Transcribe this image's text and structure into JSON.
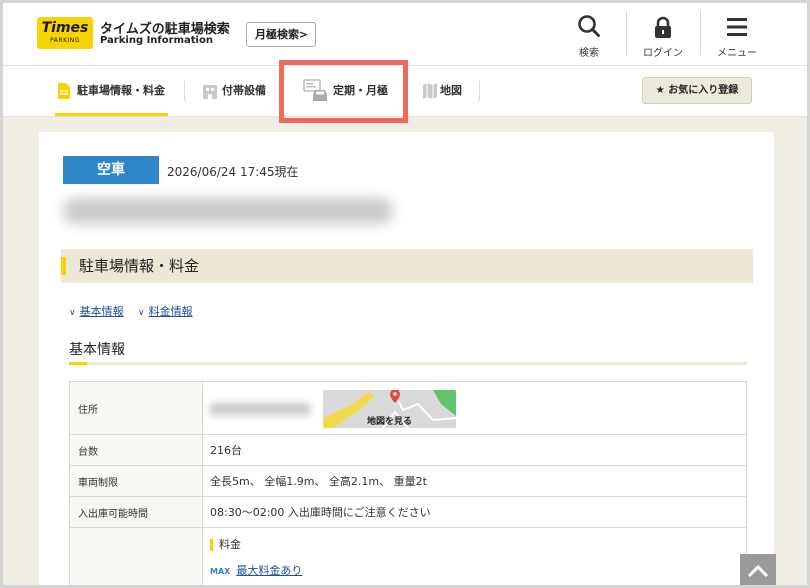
{
  "header": {
    "logo_text": "Times",
    "logo_sub": "PARKING",
    "site_title": "タイムズの駐車場検索",
    "site_subtitle": "Parking Information",
    "monthly_search_label": "月極検索",
    "icons": [
      {
        "name": "search-icon",
        "label": "検索"
      },
      {
        "name": "lock-icon",
        "label": "ログイン"
      },
      {
        "name": "menu-icon",
        "label": "メニュー"
      }
    ]
  },
  "tabs": {
    "items": [
      {
        "label": "駐車場情報・料金",
        "icon": "document-icon",
        "active": true
      },
      {
        "label": "付帯設備",
        "icon": "building-icon",
        "active": false
      },
      {
        "label": "定期・月極",
        "icon": "car-card-icon",
        "active": false
      },
      {
        "label": "地図",
        "icon": "map-icon",
        "active": false
      }
    ],
    "favorite_label": "お気に入り登録"
  },
  "status": {
    "badge": "空車",
    "timestamp": "2026/06/24 17:45現在"
  },
  "section": {
    "title": "駐車場情報・料金",
    "anchors": [
      "基本情報",
      "料金情報"
    ],
    "subtitle": "基本情報"
  },
  "table": {
    "rows": [
      {
        "label": "住所",
        "value": ""
      },
      {
        "label": "台数",
        "value": "216台"
      },
      {
        "label": "車両制限",
        "value": "全長5m、 全幅1.9m、 全高2.1m、 重量2t"
      },
      {
        "label": "入出庫可能時間",
        "value": "08:30～02:00 入出庫時間にご注意ください"
      },
      {
        "label": "",
        "value": ""
      }
    ],
    "map_button_label": "地図を見る",
    "fee_label": "料金",
    "max_tag": "MAX",
    "max_link": "最大料金あり"
  },
  "colors": {
    "brand_yellow": "#f7d300",
    "vacant_blue": "#2f86c9",
    "highlight_red": "#ee6a59",
    "section_beige": "#ece7d6"
  }
}
